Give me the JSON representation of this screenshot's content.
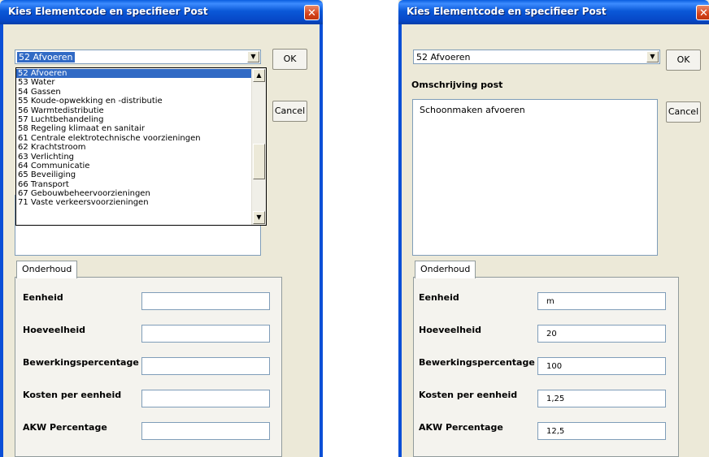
{
  "left_dialog": {
    "title": "Kies Elementcode en specifieer Post",
    "combo_value": "52 Afvoeren",
    "ok_label": "OK",
    "cancel_label": "Cancel",
    "dropdown_items": [
      "52 Afvoeren",
      "53 Water",
      "54 Gassen",
      "55 Koude-opwekking en -distributie",
      "56 Warmtedistributie",
      "57 Luchtbehandeling",
      "58 Regeling klimaat en sanitair",
      "61 Centrale elektrotechnische voorzieningen",
      "62 Krachtstroom",
      "63 Verlichting",
      "64 Communicatie",
      "65 Beveiliging",
      "66 Transport",
      "67 Gebouwbeheervoorzieningen",
      "71 Vaste verkeersvoorzieningen"
    ],
    "tab_label": "Onderhoud",
    "fields": [
      {
        "label": "Eenheid",
        "value": ""
      },
      {
        "label": "Hoeveelheid",
        "value": ""
      },
      {
        "label": "Bewerkingspercentage",
        "value": ""
      },
      {
        "label": "Kosten per eenheid",
        "value": ""
      },
      {
        "label": "AKW Percentage",
        "value": ""
      }
    ]
  },
  "right_dialog": {
    "title": "Kies Elementcode en specifieer Post",
    "combo_value": "52 Afvoeren",
    "ok_label": "OK",
    "cancel_label": "Cancel",
    "description_label": "Omschrijving post",
    "description_text": "Schoonmaken afvoeren",
    "tab_label": "Onderhoud",
    "fields": [
      {
        "label": "Eenheid",
        "value": "m"
      },
      {
        "label": "Hoeveelheid",
        "value": "20"
      },
      {
        "label": "Bewerkingspercentage",
        "value": "100"
      },
      {
        "label": "Kosten per eenheid",
        "value": "1,25"
      },
      {
        "label": "AKW Percentage",
        "value": "12,5"
      }
    ]
  },
  "icons": {
    "close": "close-icon",
    "combo_arrow": "chevron-down-icon",
    "scroll_up": "scroll-up-icon",
    "scroll_down": "scroll-down-icon"
  }
}
